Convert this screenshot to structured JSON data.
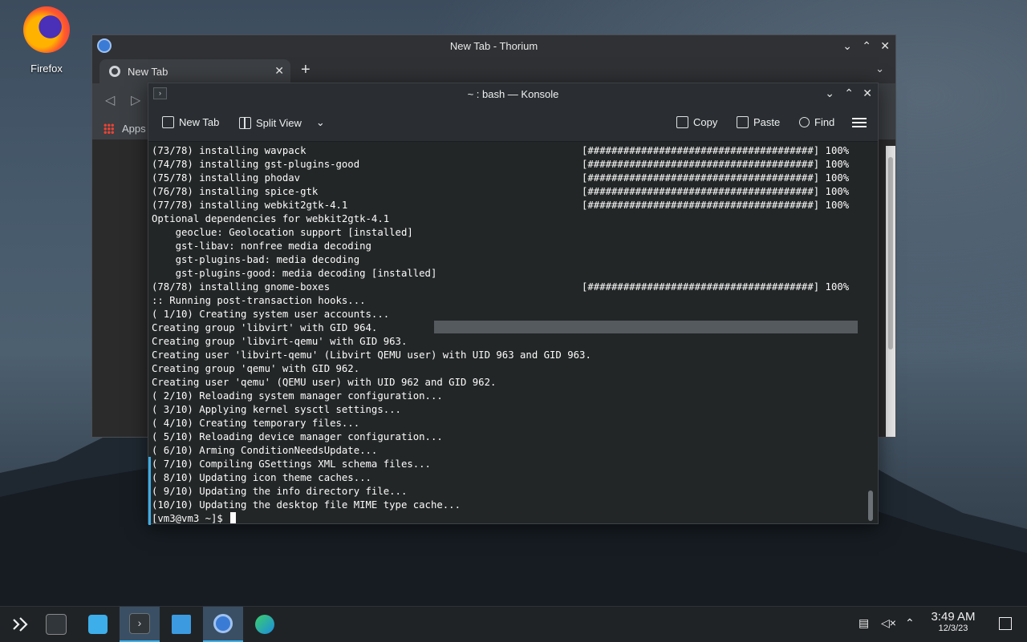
{
  "desktop": {
    "icons": [
      {
        "label": "Firefox",
        "icon": "firefox-icon"
      }
    ]
  },
  "browser": {
    "title": "New Tab - Thorium",
    "tab_label": "New Tab",
    "bookmarks_apps": "Apps"
  },
  "konsole": {
    "title": "~ : bash — Konsole",
    "toolbar": {
      "new_tab": "New Tab",
      "split_view": "Split View",
      "copy": "Copy",
      "paste": "Paste",
      "find": "Find"
    },
    "lines": [
      {
        "left": "(73/78) installing wavpack",
        "right": "[######################################] 100%"
      },
      {
        "left": "(74/78) installing gst-plugins-good",
        "right": "[######################################] 100%"
      },
      {
        "left": "(75/78) installing phodav",
        "right": "[######################################] 100%"
      },
      {
        "left": "(76/78) installing spice-gtk",
        "right": "[######################################] 100%"
      },
      {
        "left": "(77/78) installing webkit2gtk-4.1",
        "right": "[######################################] 100%"
      },
      {
        "left": "Optional dependencies for webkit2gtk-4.1",
        "right": ""
      },
      {
        "left": "    geoclue: Geolocation support [installed]",
        "right": ""
      },
      {
        "left": "    gst-libav: nonfree media decoding",
        "right": ""
      },
      {
        "left": "    gst-plugins-bad: media decoding",
        "right": ""
      },
      {
        "left": "    gst-plugins-good: media decoding [installed]",
        "right": ""
      },
      {
        "left": "(78/78) installing gnome-boxes",
        "right": "[######################################] 100%"
      },
      {
        "left": ":: Running post-transaction hooks...",
        "right": ""
      },
      {
        "left": "( 1/10) Creating system user accounts...",
        "right": ""
      },
      {
        "left": "Creating group 'libvirt' with GID 964.",
        "right": ""
      },
      {
        "left": "Creating group 'libvirt-qemu' with GID 963.",
        "right": ""
      },
      {
        "left": "Creating user 'libvirt-qemu' (Libvirt QEMU user) with UID 963 and GID 963.",
        "right": ""
      },
      {
        "left": "Creating group 'qemu' with GID 962.",
        "right": ""
      },
      {
        "left": "Creating user 'qemu' (QEMU user) with UID 962 and GID 962.",
        "right": ""
      },
      {
        "left": "( 2/10) Reloading system manager configuration...",
        "right": ""
      },
      {
        "left": "( 3/10) Applying kernel sysctl settings...",
        "right": ""
      },
      {
        "left": "( 4/10) Creating temporary files...",
        "right": ""
      },
      {
        "left": "( 5/10) Reloading device manager configuration...",
        "right": ""
      },
      {
        "left": "( 6/10) Arming ConditionNeedsUpdate...",
        "right": ""
      },
      {
        "left": "( 7/10) Compiling GSettings XML schema files...",
        "right": ""
      },
      {
        "left": "( 8/10) Updating icon theme caches...",
        "right": ""
      },
      {
        "left": "( 9/10) Updating the info directory file...",
        "right": ""
      },
      {
        "left": "(10/10) Updating the desktop file MIME type cache...",
        "right": ""
      }
    ],
    "prompt": "[vm3@vm3 ~]$ "
  },
  "taskbar": {
    "apps": [
      {
        "name": "application-launcher-icon"
      },
      {
        "name": "system-settings-icon"
      },
      {
        "name": "discover-store-icon"
      },
      {
        "name": "konsole-icon"
      },
      {
        "name": "dolphin-files-icon"
      },
      {
        "name": "thorium-browser-icon"
      },
      {
        "name": "edge-browser-icon"
      }
    ],
    "clock": {
      "time": "3:49 AM",
      "date": "12/3/23"
    }
  },
  "colors": {
    "accent": "#3daee9",
    "terminal_bg": "#232627",
    "taskbar_bg": "#202326"
  }
}
